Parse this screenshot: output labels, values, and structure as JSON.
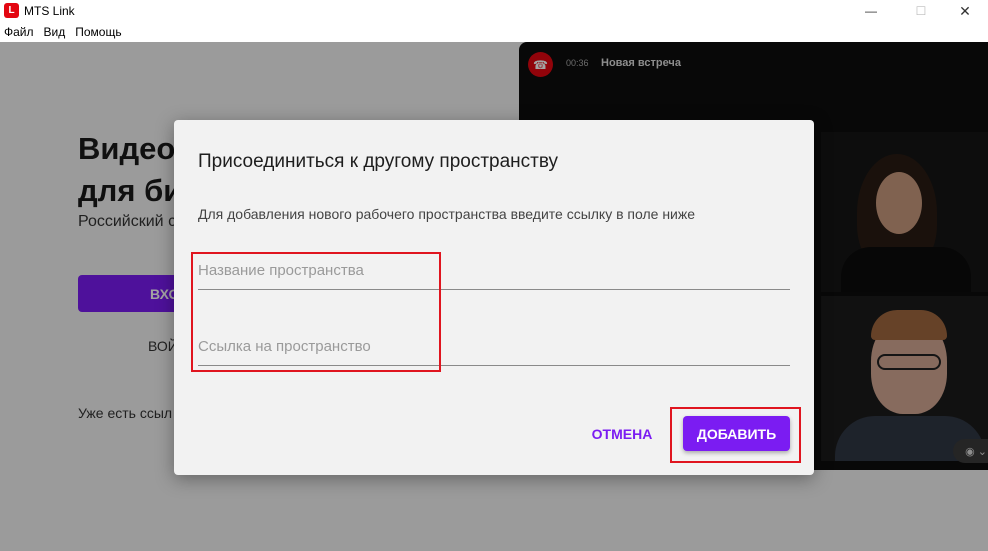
{
  "window": {
    "title": "MTS Link",
    "logo_text": "L",
    "minimize_glyph": "—",
    "maximize_glyph": "☐",
    "close_glyph": "✕"
  },
  "menu": {
    "items": [
      "Файл",
      "Вид",
      "Помощь"
    ]
  },
  "background": {
    "hero_line1": "Видео",
    "hero_line2": "для би",
    "hero_subtitle": "Российский с",
    "login_label": "ВХО",
    "register_label": "ВОЙ",
    "have_account": "Уже есть ссыл"
  },
  "meeting": {
    "time": "00:36",
    "title": "Новая встреча"
  },
  "dialog": {
    "title": "Присоединиться к другому пространству",
    "description": "Для добавления нового рабочего пространства введите ссылку в поле ниже",
    "name_placeholder": "Название пространства",
    "link_placeholder": "Ссылка на пространство",
    "name_value": "",
    "link_value": "",
    "cancel_label": "ОТМЕНА",
    "add_label": "ДОБАВИТЬ"
  },
  "colors": {
    "accent": "#7b1cf2",
    "brand_red": "#e30611",
    "highlight": "#e0151f"
  }
}
